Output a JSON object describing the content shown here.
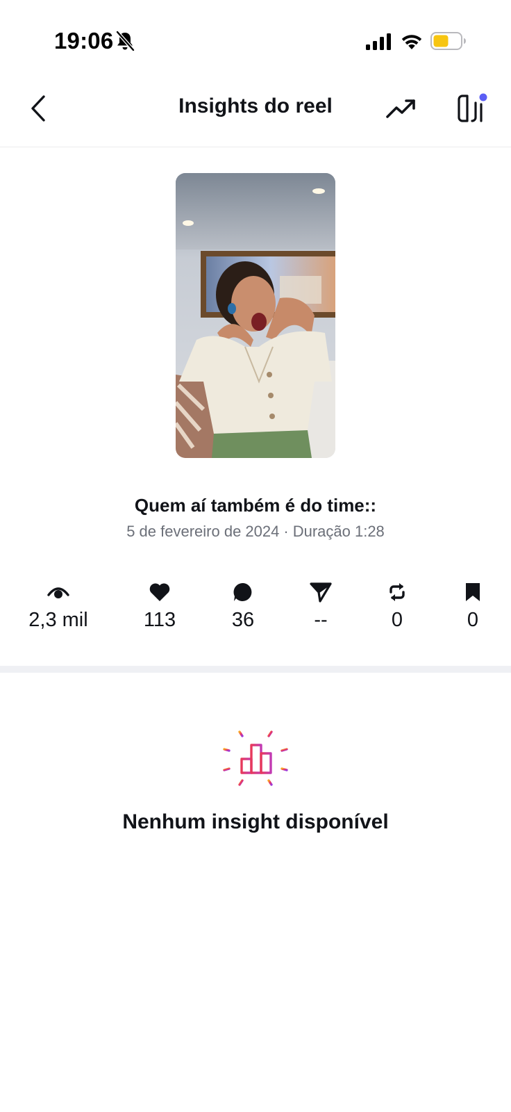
{
  "status_bar": {
    "time": "19:06",
    "icons": [
      "bell-off-icon",
      "signal-icon",
      "wifi-icon",
      "battery-icon"
    ],
    "battery_color": "#f7c511"
  },
  "header": {
    "title": "Insights do reel",
    "back_icon": "chevron-left-icon",
    "trend_icon": "trending-up-icon",
    "panel_icon": "side-panel-icon",
    "notification_dot_color": "#5b5ef5"
  },
  "reel": {
    "thumbnail_description_icon": "video-thumbnail",
    "caption": "Quem aí também é do time::",
    "date": "5 de fevereiro de 2024",
    "separator": "·",
    "duration": "Duração 1:28"
  },
  "stats": [
    {
      "icon": "eye-icon",
      "value": "2,3 mil"
    },
    {
      "icon": "heart-icon",
      "value": "113"
    },
    {
      "icon": "comment-icon",
      "value": "36"
    },
    {
      "icon": "share-icon",
      "value": "--"
    },
    {
      "icon": "repost-icon",
      "value": "0"
    },
    {
      "icon": "bookmark-icon",
      "value": "0"
    }
  ],
  "empty_state": {
    "icon": "bar-chart-sparkle-icon",
    "title": "Nenhum insight disponível"
  }
}
